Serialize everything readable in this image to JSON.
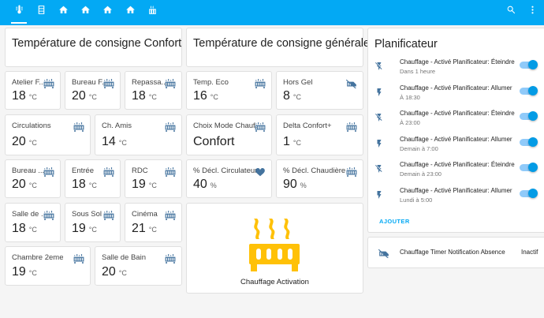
{
  "tabs": [
    {
      "icon": "thermometer-icon"
    },
    {
      "icon": "radiator-icon"
    },
    {
      "icon": "home-icon"
    },
    {
      "icon": "home-floor-1-icon"
    },
    {
      "icon": "home-floor-2-icon"
    },
    {
      "icon": "home-floor-3-icon"
    },
    {
      "icon": "heating-icon"
    }
  ],
  "toolbar": {
    "search_icon": "search-icon",
    "menu_icon": "dots-vertical-icon"
  },
  "confort": {
    "title": "Température de consigne Confort",
    "tiles": [
      {
        "name": "Atelier F...",
        "value": "18",
        "unit": "°C"
      },
      {
        "name": "Bureau F...",
        "value": "20",
        "unit": "°C"
      },
      {
        "name": "Repassa...",
        "value": "18",
        "unit": "°C"
      },
      {
        "name": "Circulations",
        "value": "20",
        "unit": "°C"
      },
      {
        "name": "Ch. Amis",
        "value": "14",
        "unit": "°C"
      },
      {
        "name": "Bureau ...",
        "value": "20",
        "unit": "°C"
      },
      {
        "name": "Entrée",
        "value": "18",
        "unit": "°C"
      },
      {
        "name": "RDC",
        "value": "19",
        "unit": "°C"
      },
      {
        "name": "Salle de ...",
        "value": "18",
        "unit": "°C"
      },
      {
        "name": "Sous Sol",
        "value": "19",
        "unit": "°C"
      },
      {
        "name": "Cinéma",
        "value": "21",
        "unit": "°C"
      },
      {
        "name": "Chambre 2eme",
        "value": "19",
        "unit": "°C"
      },
      {
        "name": "Salle de Bain",
        "value": "20",
        "unit": "°C"
      }
    ]
  },
  "generales": {
    "title": "Température de consigne générales",
    "tiles": [
      {
        "name": "Temp. Eco",
        "value": "16",
        "unit": "°C"
      },
      {
        "name": "Hors Gel",
        "value": "8",
        "unit": "°C"
      },
      {
        "name": "Choix Mode Chauf...",
        "value": "Confort",
        "unit": ""
      },
      {
        "name": "Delta Confort+",
        "value": "1",
        "unit": "°C"
      },
      {
        "name": "% Décl. Circulateur",
        "value": "40",
        "unit": "%"
      },
      {
        "name": "% Décl. Chaudière",
        "value": "90",
        "unit": "%"
      }
    ],
    "activation": {
      "label": "Chauffage Activation"
    }
  },
  "planificateur": {
    "title": "Planificateur",
    "rows": [
      {
        "name": "Chauffage - Activé Planificateur: Éteindre",
        "sub": "Dans 1 heure",
        "icon": "flash-off-icon"
      },
      {
        "name": "Chauffage - Activé Planificateur: Allumer",
        "sub": "À 18:30",
        "icon": "flash-icon"
      },
      {
        "name": "Chauffage - Activé Planificateur: Éteindre",
        "sub": "À 23:00",
        "icon": "flash-off-icon"
      },
      {
        "name": "Chauffage - Activé Planificateur: Allumer",
        "sub": "Demain à 7:00",
        "icon": "flash-icon"
      },
      {
        "name": "Chauffage - Activé Planificateur: Éteindre",
        "sub": "Demain à 23:00",
        "icon": "flash-off-icon"
      },
      {
        "name": "Chauffage - Activé Planificateur: Allumer",
        "sub": "Lundi à 5:00",
        "icon": "flash-icon"
      }
    ],
    "add_label": "AJOUTER"
  },
  "timer": {
    "name": "Chauffage Timer Notification Absence",
    "state": "Inactif"
  },
  "colors": {
    "header": "#03a9f4",
    "icon": "#44739e",
    "accent": "#ffc107",
    "toggle": "#039be5"
  }
}
